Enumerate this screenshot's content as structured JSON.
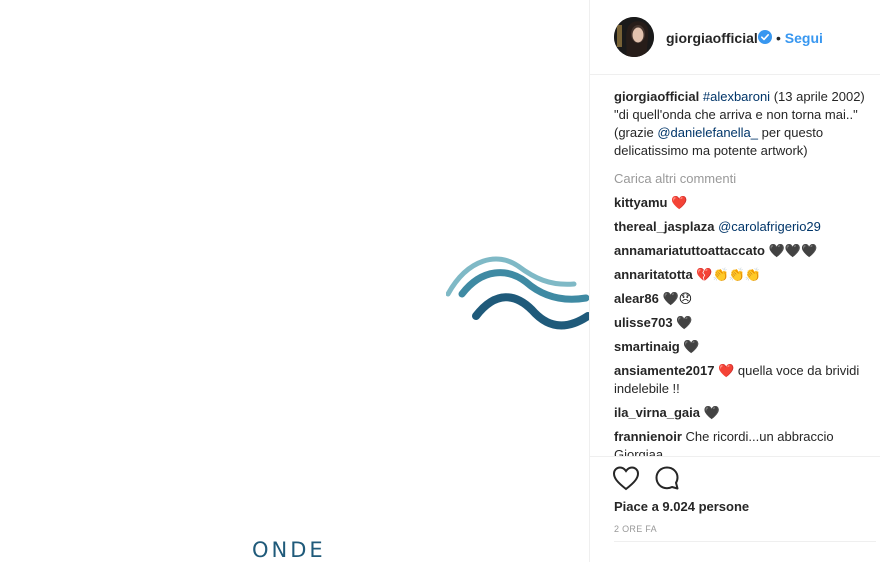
{
  "artwork": {
    "title": "ONDE",
    "colors": {
      "wave_light": "#7fb9c6",
      "wave_mid": "#3f8aa3",
      "wave_dark": "#1f5a7a"
    }
  },
  "header": {
    "username": "giorgiaofficial",
    "separator": "•",
    "follow_label": "Segui",
    "verified_icon": "verified-badge-icon"
  },
  "caption": {
    "username": "giorgiaofficial",
    "hashtag": "#alexbaroni",
    "text_1": " (13 aprile 2002) \"di quell'onda che arriva e non torna mai..\" (grazie ",
    "mention": "@danielefanella_",
    "text_2": " per questo delicatissimo ma potente artwork)"
  },
  "load_more": "Carica altri commenti",
  "comments": [
    {
      "user": "kittyamu",
      "text": "",
      "emoji": "❤️"
    },
    {
      "user": "thereal_jasplaza",
      "text": "",
      "mention": "@carolafrigerio29"
    },
    {
      "user": "annamariatuttoattaccato",
      "text": "",
      "emoji": "🖤🖤🖤"
    },
    {
      "user": "annaritatotta",
      "text": "",
      "emoji": "💔👏👏👏"
    },
    {
      "user": "alear86",
      "text": "",
      "emoji": "🖤😞"
    },
    {
      "user": "ulisse703",
      "text": "",
      "emoji": "🖤"
    },
    {
      "user": "smartinaig",
      "text": "",
      "emoji": "🖤"
    },
    {
      "user": "ansiamente2017",
      "emoji": "❤️",
      "text": " quella voce da brividi indelebile !!"
    },
    {
      "user": "ila_virna_gaia",
      "text": "",
      "emoji": "🖤"
    },
    {
      "user": "frannienoir",
      "text": " Che ricordi...un abbraccio Giorgiaa",
      "emoji": ""
    }
  ],
  "actions": {
    "like_icon": "heart-outline-icon",
    "comment_icon": "speech-bubble-icon",
    "likes_text": "Piace a 9.024 persone",
    "timestamp": "2 ORE FA"
  }
}
